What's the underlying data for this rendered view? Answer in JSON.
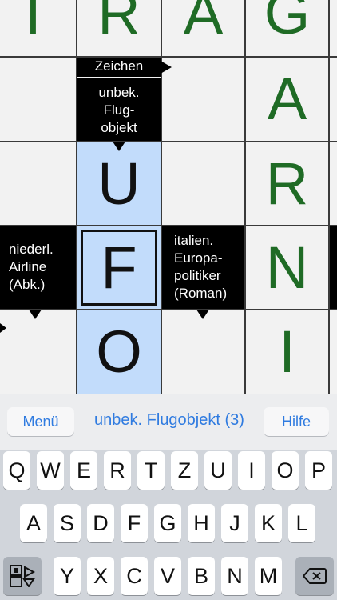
{
  "grid": {
    "letters": [
      {
        "char": "T",
        "col": 0,
        "row": 0,
        "color": "green"
      },
      {
        "char": "R",
        "col": 1,
        "row": 0,
        "color": "green"
      },
      {
        "char": "A",
        "col": 2,
        "row": 0,
        "color": "green"
      },
      {
        "char": "G",
        "col": 3,
        "row": 0,
        "color": "green"
      },
      {
        "char": "A",
        "col": 3,
        "row": 1,
        "color": "green"
      },
      {
        "char": "U",
        "col": 1,
        "row": 2,
        "color": "black"
      },
      {
        "char": "R",
        "col": 3,
        "row": 2,
        "color": "green"
      },
      {
        "char": "F",
        "col": 1,
        "row": 3,
        "color": "black"
      },
      {
        "char": "N",
        "col": 3,
        "row": 3,
        "color": "green"
      },
      {
        "char": "O",
        "col": 1,
        "row": 4,
        "color": "black"
      },
      {
        "char": "I",
        "col": 3,
        "row": 4,
        "color": "green"
      }
    ],
    "selected_cells": [
      [
        1,
        2
      ],
      [
        1,
        3
      ],
      [
        1,
        4
      ]
    ],
    "focused_cell": [
      1,
      3
    ],
    "clues": {
      "zeichen": "Zeichen",
      "ufo": [
        "unbek.",
        "Flug-",
        "objekt"
      ],
      "airline": [
        "niederl.",
        "Airline",
        "(Abk.)"
      ],
      "politiker": [
        "italien.",
        "Europa-",
        "politiker",
        "(Roman)"
      ]
    }
  },
  "keyboard": {
    "menu_label": "Menü",
    "clue_label": "unbek. Flugobjekt (3)",
    "help_label": "Hilfe",
    "row1": [
      "Q",
      "W",
      "E",
      "R",
      "T",
      "Z",
      "U",
      "I",
      "O",
      "P"
    ],
    "row2": [
      "A",
      "S",
      "D",
      "F",
      "G",
      "H",
      "J",
      "K",
      "L"
    ],
    "row3": [
      "Y",
      "X",
      "C",
      "V",
      "B",
      "N",
      "M"
    ],
    "icons": {
      "left": "grid-toggle-icon",
      "right": "backspace-icon"
    }
  }
}
